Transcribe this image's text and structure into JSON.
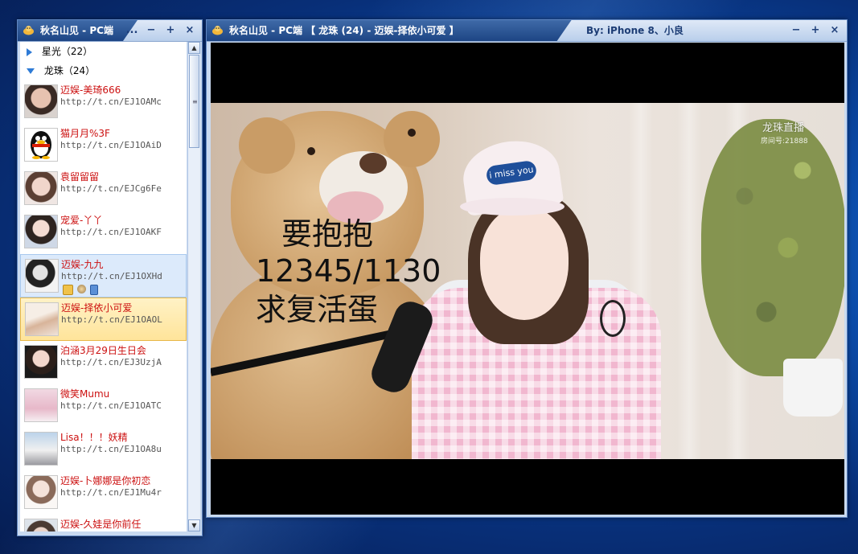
{
  "list_window": {
    "title": "秋名山见 - PC端",
    "buttons": [
      "...",
      "−",
      "+",
      "×"
    ]
  },
  "groups": [
    {
      "label": "星光（22）",
      "expanded": false
    },
    {
      "label": "龙珠（24）",
      "expanded": true
    }
  ],
  "contacts": [
    {
      "name": "迈娱-美琦666",
      "sig": "http://t.cn/EJ1OAMc",
      "state": "normal"
    },
    {
      "name": "猫月月%3F",
      "sig": "http://t.cn/EJ1OAiD",
      "state": "normal"
    },
    {
      "name": "袁留留留",
      "sig": "http://t.cn/EJCg6Fe",
      "state": "normal"
    },
    {
      "name": "宠爱-丫丫",
      "sig": "http://t.cn/EJ1OAKF",
      "state": "normal"
    },
    {
      "name": "迈娱-九九",
      "sig": "http://t.cn/EJ1OXHd",
      "state": "hover"
    },
    {
      "name": "迈娱-择依小可爱",
      "sig": "http://t.cn/EJ1OAOL",
      "state": "selected"
    },
    {
      "name": "泊涵3月29日生日会",
      "sig": "http://t.cn/EJ3UzjA",
      "state": "normal"
    },
    {
      "name": "微笑Mumu",
      "sig": "http://t.cn/EJ1OATC",
      "state": "normal"
    },
    {
      "name": "Lisa！！！妖精",
      "sig": "http://t.cn/EJ1OA8u",
      "state": "normal"
    },
    {
      "name": "迈娱-卜娜娜是你初恋",
      "sig": "http://t.cn/EJ1Mu4r",
      "state": "normal"
    },
    {
      "name": "迈娱-久娃是你前任",
      "sig": "",
      "state": "normal"
    }
  ],
  "video_window": {
    "title": "秋名山见 - PC端 【 龙珠 (24)  -  迈娱-择依小可爱 】",
    "byline": "By:  iPhone 8、小良",
    "buttons": [
      "−",
      "+",
      "×"
    ]
  },
  "video": {
    "overlay_lines": [
      "要抱抱",
      "12345/1130",
      "求复活蛋"
    ],
    "watermark": "龙珠直播",
    "room_label": "房间号:21888",
    "cap_text": "i miss you"
  },
  "colors": {
    "title_tab": "#1d4584",
    "contact_name": "#cc1010",
    "selected_bg": "#ffe49a",
    "hover_bg": "#dceafb"
  },
  "icons": [
    "qq-pet-icon",
    "mail-icon",
    "qq-show-icon",
    "mobile-icon",
    "expand-arrow-icon",
    "collapse-arrow-icon"
  ]
}
